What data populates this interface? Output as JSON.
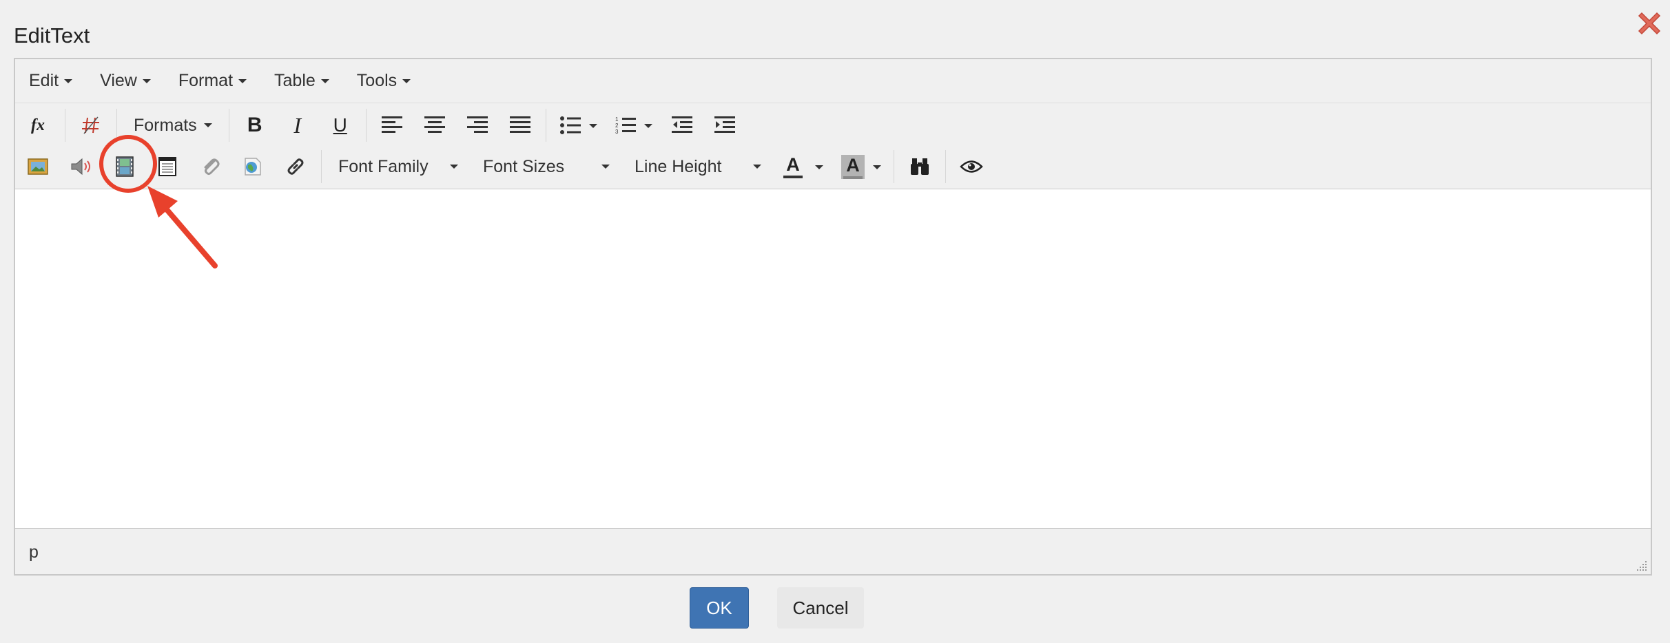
{
  "dialog": {
    "title": "EditText",
    "close_icon": "close-x-icon",
    "ok_label": "OK",
    "cancel_label": "Cancel"
  },
  "menubar": {
    "items": [
      {
        "label": "Edit"
      },
      {
        "label": "View"
      },
      {
        "label": "Format"
      },
      {
        "label": "Table"
      },
      {
        "label": "Tools"
      }
    ]
  },
  "toolbar": {
    "row1": {
      "formula_label": "fx",
      "formats_label": "Formats",
      "bold_label": "B",
      "italic_label": "I",
      "underline_label": "U"
    },
    "row2": {
      "font_family_label": "Font Family",
      "font_sizes_label": "Font Sizes",
      "line_height_label": "Line Height",
      "text_color_label": "A",
      "bg_color_label": "A"
    }
  },
  "status": {
    "path": "p"
  },
  "colors": {
    "accent": "#3f74b3",
    "annotation": "#e8412c",
    "close": "#e06a5a"
  }
}
